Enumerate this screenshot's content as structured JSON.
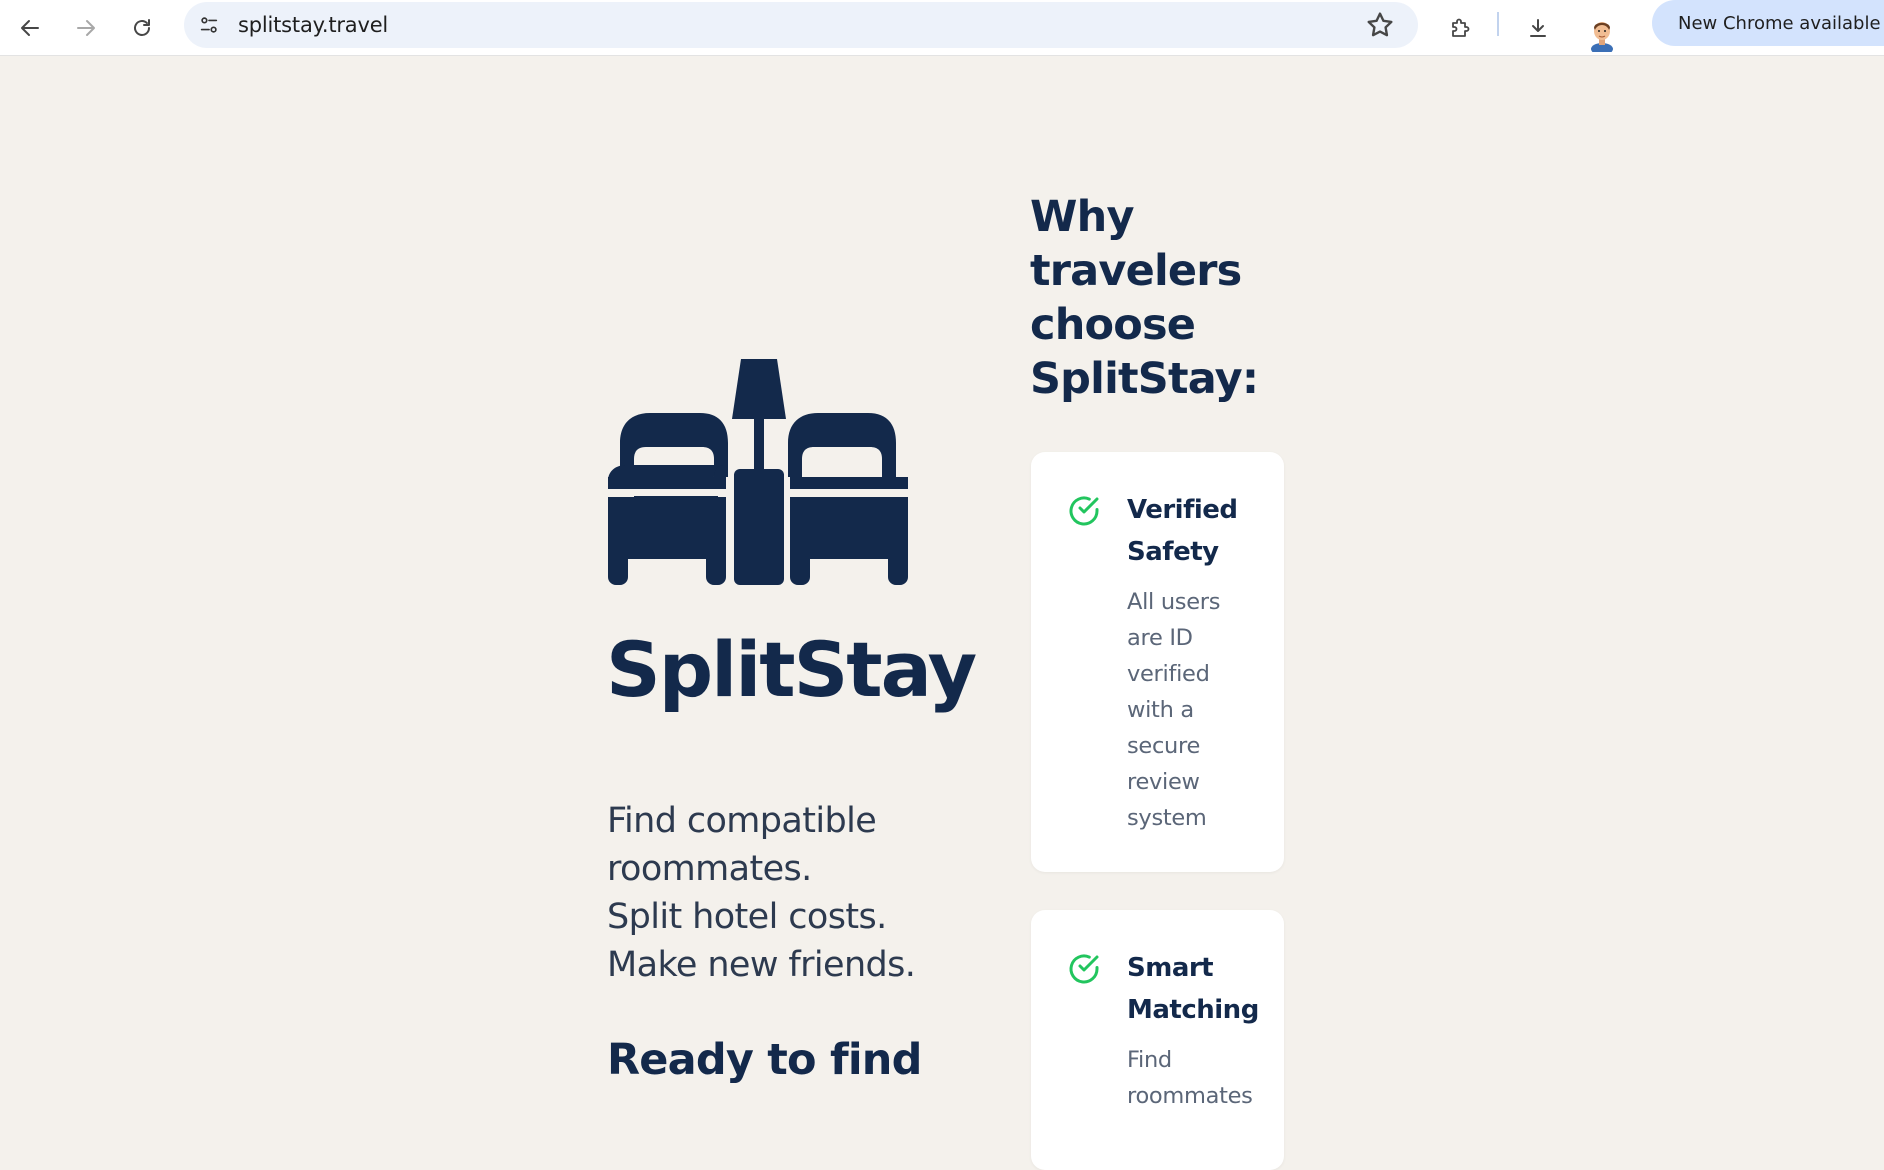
{
  "browser": {
    "url": "splitstay.travel",
    "update_label": "New Chrome available"
  },
  "icons": {
    "back": "back-arrow-icon",
    "forward": "forward-arrow-icon",
    "reload": "reload-icon",
    "site_info": "site-settings-icon",
    "bookmark": "star-icon",
    "extensions": "puzzle-icon",
    "downloads": "download-icon",
    "profile": "avatar",
    "menu": "more-vert-icon",
    "logo": "beds-lamp-logo",
    "check": "check-circle-icon"
  },
  "colors": {
    "page_bg": "#f4f1ec",
    "navy": "#13294b",
    "check_green": "#22c55e"
  },
  "hero": {
    "brand": "SplitStay",
    "tagline_lines": [
      "Find compatible",
      "roommates.",
      "Split hotel costs.",
      "Make new friends."
    ],
    "cta": "Ready to find"
  },
  "features": {
    "heading_lines": [
      "Why",
      "travelers",
      "choose",
      "SplitStay:"
    ],
    "cards": [
      {
        "title_lines": [
          "Verified",
          "Safety"
        ],
        "desc_lines": [
          "All users",
          "are ID",
          "verified",
          "with a",
          "secure",
          "review",
          "system"
        ]
      },
      {
        "title_lines": [
          "Smart",
          "Matching"
        ],
        "desc_lines": [
          "Find",
          "roommates"
        ]
      }
    ]
  }
}
